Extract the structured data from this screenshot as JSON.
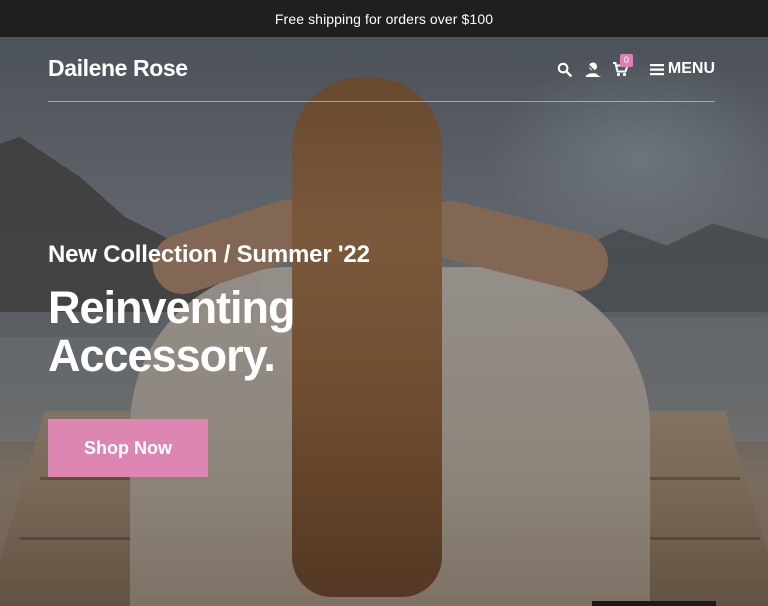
{
  "announcement": {
    "text": "Free shipping for orders over $100"
  },
  "header": {
    "logo": "Dailene Rose",
    "icons": [
      "search-icon",
      "account-icon",
      "cart-icon",
      "hamburger-icon"
    ],
    "cart_count": "0",
    "menu_label": "MENU"
  },
  "hero": {
    "subtitle": "New Collection / Summer '22",
    "headline": "Reinventing Accessory.",
    "cta_label": "Shop Now"
  },
  "colors": {
    "announcement_bg": "#1f1f1f",
    "accent_pink": "#de86b2",
    "badge_pink": "#e07fb5",
    "text": "#ffffff"
  }
}
